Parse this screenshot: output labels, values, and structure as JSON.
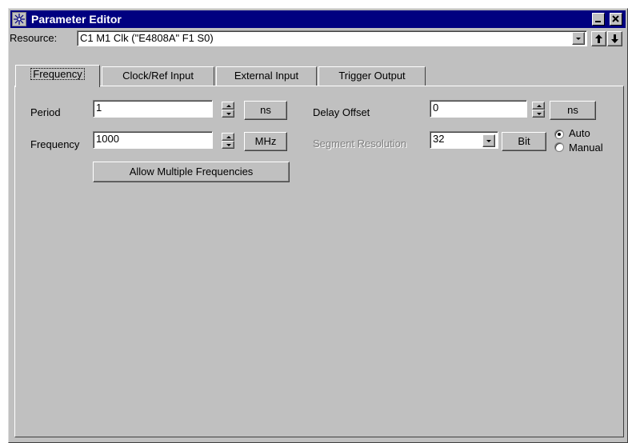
{
  "window": {
    "title": "Parameter Editor",
    "app_icon": "starburst-icon",
    "minimize_icon": "minimize-icon",
    "close_icon": "close-icon"
  },
  "resource": {
    "label": "Resource:",
    "value": "C1 M1 Clk (\"E4808A\" F1 S0)",
    "up_icon": "arrow-up-icon",
    "down_icon": "arrow-down-icon"
  },
  "tabs": [
    {
      "label": "Frequency",
      "active": true
    },
    {
      "label": "Clock/Ref Input",
      "active": false
    },
    {
      "label": "External Input",
      "active": false
    },
    {
      "label": "Trigger Output",
      "active": false
    }
  ],
  "frequency_tab": {
    "period": {
      "label": "Period",
      "value": "1",
      "unit": "ns"
    },
    "frequency": {
      "label": "Frequency",
      "value": "1000",
      "unit": "MHz"
    },
    "allow_multiple_label": "Allow Multiple Frequencies",
    "delay_offset": {
      "label": "Delay Offset",
      "value": "0",
      "unit": "ns"
    },
    "segment_resolution": {
      "label": "Segment Resolution",
      "value": "32",
      "unit": "Bit",
      "enabled": false
    },
    "mode": {
      "options": [
        "Auto",
        "Manual"
      ],
      "selected": "Auto"
    }
  }
}
